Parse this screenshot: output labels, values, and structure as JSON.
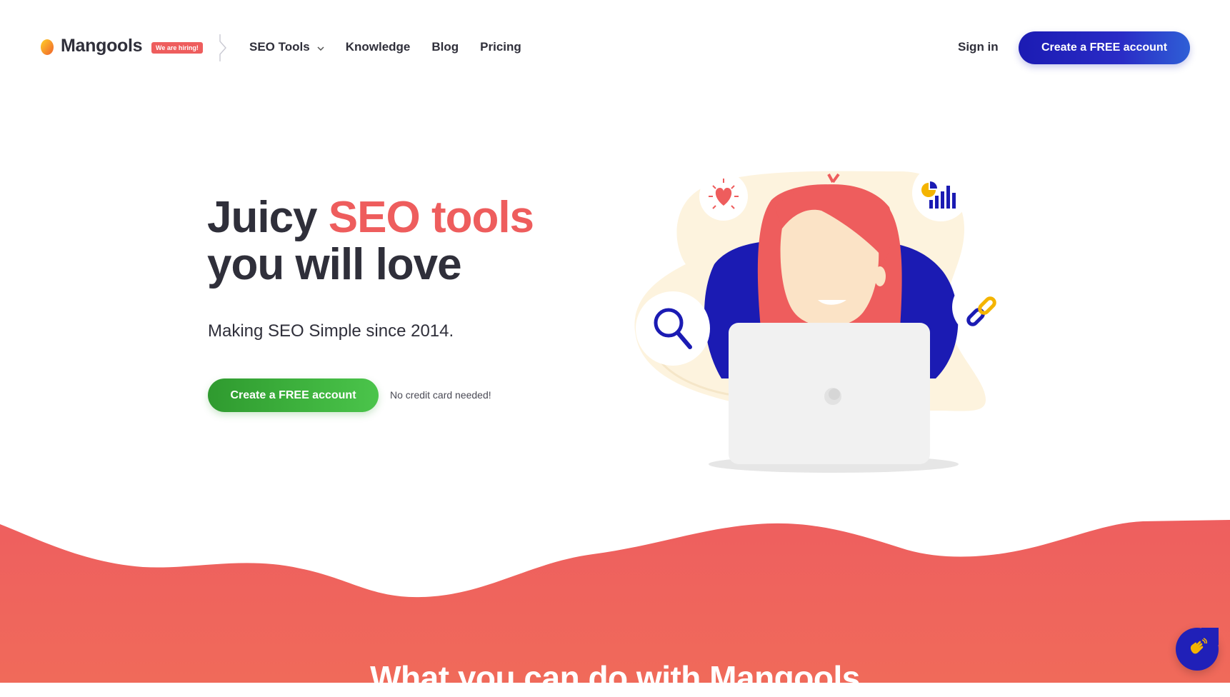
{
  "header": {
    "logo_text": "Mangools",
    "hiring_badge": "We are hiring!",
    "nav": [
      {
        "label": "SEO Tools",
        "has_dropdown": true
      },
      {
        "label": "Knowledge"
      },
      {
        "label": "Blog"
      },
      {
        "label": "Pricing"
      }
    ],
    "sign_in": "Sign in",
    "cta": "Create a FREE account"
  },
  "hero": {
    "title_part1": "Juicy ",
    "title_accent": "SEO tools",
    "title_line2": "you will love",
    "subtitle": "Making SEO Simple since 2014.",
    "cta": "Create a FREE account",
    "note": "No credit card needed!"
  },
  "section": {
    "title": "What you can do with Mangools"
  },
  "chat_widget": {
    "icon": "waving-hand-icon"
  },
  "colors": {
    "accent_red": "#ee5d5d",
    "brand_blue": "#1b1bb3",
    "cta_green": "#3fb43f",
    "text_dark": "#2f2f3a",
    "cream": "#fdf3de"
  }
}
